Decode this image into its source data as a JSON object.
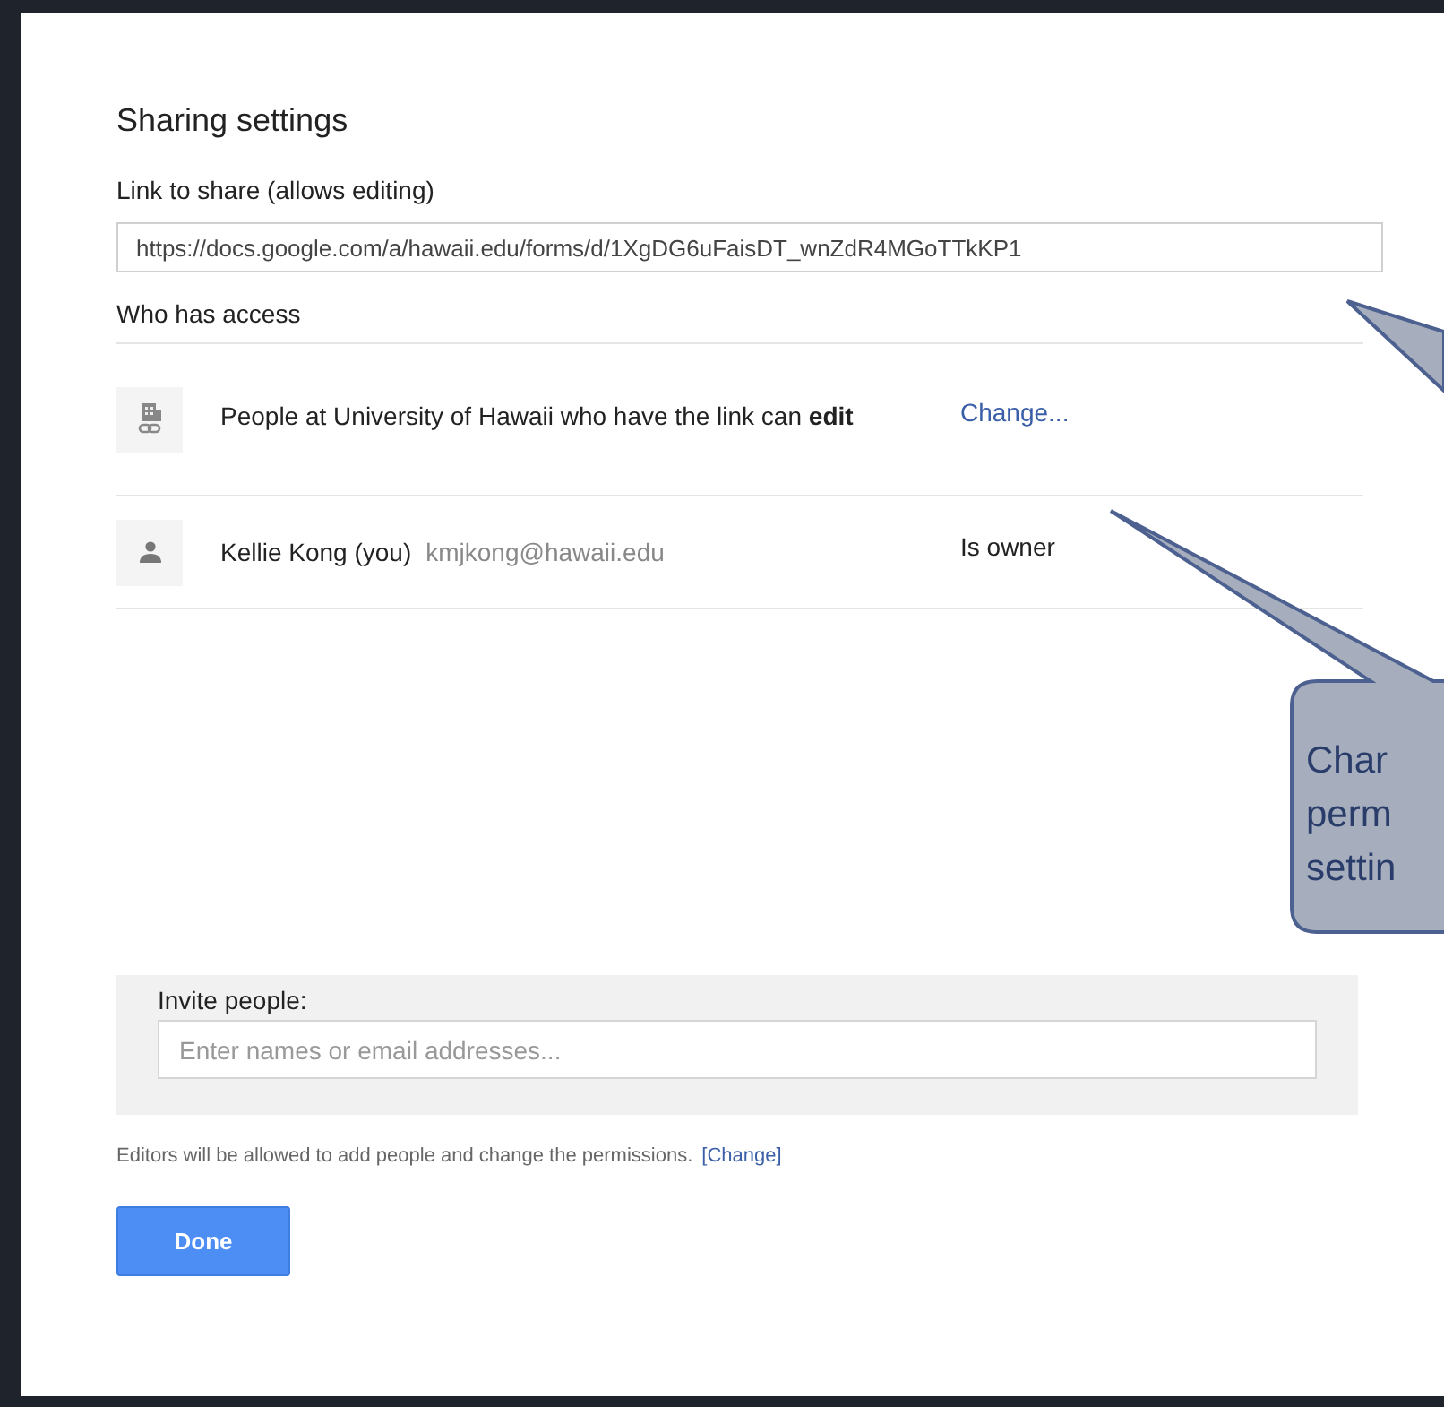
{
  "dialog": {
    "title": "Sharing settings"
  },
  "link": {
    "label": "Link to share (allows editing)",
    "value": "https://docs.google.com/a/hawaii.edu/forms/d/1XgDG6uFaisDT_wnZdR4MGoTTkKP1"
  },
  "access": {
    "label": "Who has access",
    "rows": [
      {
        "kind": "link",
        "text": "People at University of Hawaii who have the link can **edit**",
        "action": "Change..."
      },
      {
        "kind": "person",
        "name": "Kellie Kong (you)",
        "email": "kmjkong@hawaii.edu",
        "role": "Is owner"
      }
    ]
  },
  "invite": {
    "label": "Invite people:",
    "placeholder": "Enter names or email addresses..."
  },
  "editors_note": {
    "text": "Editors will be allowed to add people and change the permissions.",
    "link": "[Change]"
  },
  "buttons": [
    "Done"
  ],
  "callouts": [
    {
      "kind": "tail"
    },
    {
      "kind": "box",
      "lines": [
        "Char",
        "perm",
        "settin"
      ]
    }
  ]
}
